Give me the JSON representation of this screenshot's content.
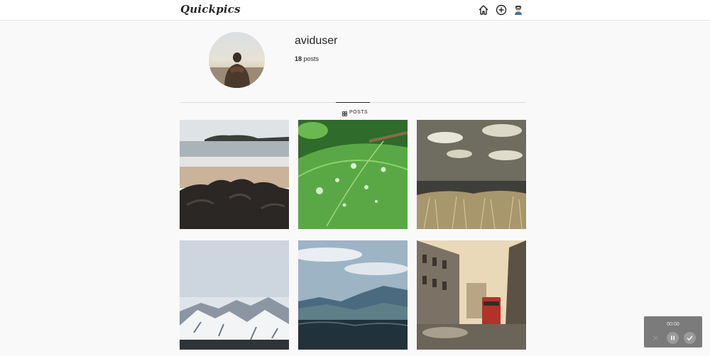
{
  "app": {
    "logo_text": "Quickpics"
  },
  "nav": {
    "icons": [
      "home-icon",
      "add-circle-icon",
      "profile-avatar-icon"
    ]
  },
  "profile": {
    "username": "aviduser",
    "posts_count": "18",
    "posts_label": "posts"
  },
  "tabs": {
    "posts_label": "POSTS"
  },
  "posts": [
    {
      "subject": "beach-rocks"
    },
    {
      "subject": "leaf-water-drops"
    },
    {
      "subject": "dry-grass-sea"
    },
    {
      "subject": "snowy-mountains"
    },
    {
      "subject": "blue-mountains"
    },
    {
      "subject": "city-street"
    }
  ],
  "recorder": {
    "time": "00:00"
  },
  "colors": {
    "text": "#262626",
    "background": "#faf9fa",
    "divider": "#dbdbdb",
    "recorder_bg": "#7b7b7b"
  }
}
